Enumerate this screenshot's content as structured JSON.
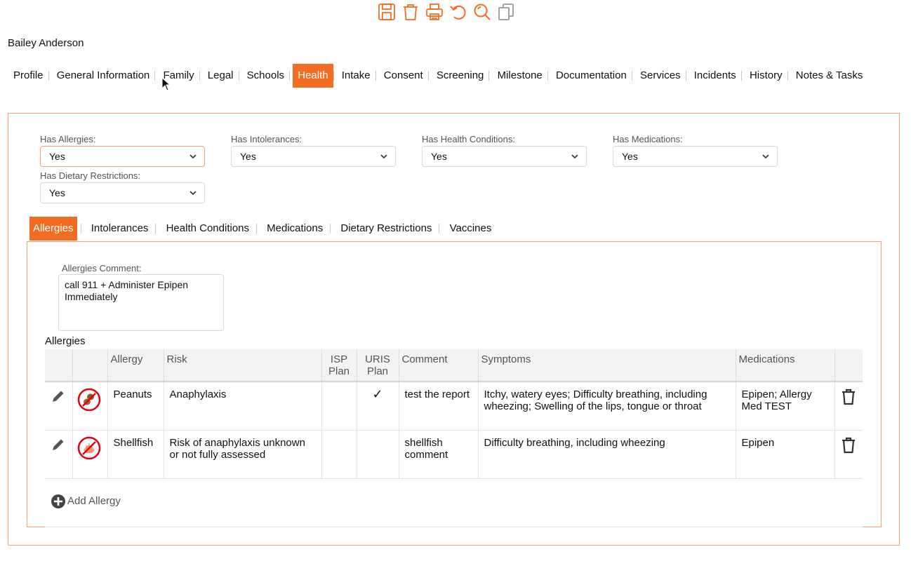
{
  "toolbar": {
    "accent_color": "#f26d21",
    "buttons": [
      {
        "name": "save-icon"
      },
      {
        "name": "trash-icon"
      },
      {
        "name": "printer-icon"
      },
      {
        "name": "undo-icon"
      },
      {
        "name": "search-icon"
      },
      {
        "name": "copy-icon"
      }
    ]
  },
  "student": {
    "name": "Bailey Anderson"
  },
  "main_nav": {
    "items": [
      "Profile",
      "General Information",
      "Family",
      "Legal",
      "Schools",
      "Health",
      "Intake",
      "Consent",
      "Screening",
      "Milestone",
      "Documentation",
      "Services",
      "Incidents",
      "History",
      "Notes & Tasks"
    ],
    "active": "Health"
  },
  "health_fields": {
    "has_allergies": {
      "label": "Has Allergies:",
      "value": "Yes"
    },
    "has_intolerances": {
      "label": "Has Intolerances:",
      "value": "Yes"
    },
    "has_health_conditions": {
      "label": "Has Health Conditions:",
      "value": "Yes"
    },
    "has_medications": {
      "label": "Has Medications:",
      "value": "Yes"
    },
    "has_dietary_restrictions": {
      "label": "Has Dietary Restrictions:",
      "value": "Yes"
    }
  },
  "sub_nav": {
    "items": [
      "Allergies",
      "Intolerances",
      "Health Conditions",
      "Medications",
      "Dietary Restrictions",
      "Vaccines"
    ],
    "active": "Allergies"
  },
  "allergies_comment": {
    "label": "Allergies Comment:",
    "value": "call 911 + Administer Epipen Immediately"
  },
  "allergies_table": {
    "heading": "Allergies",
    "columns": {
      "allergy": "Allergy",
      "risk": "Risk",
      "isp_plan_1": "ISP",
      "isp_plan_2": "Plan",
      "uris_plan_1": "URIS",
      "uris_plan_2": "Plan",
      "comment": "Comment",
      "symptoms": "Symptoms",
      "medications": "Medications"
    },
    "rows": [
      {
        "icon": "peanut-icon",
        "allergy": "Peanuts",
        "risk": "Anaphylaxis",
        "isp_plan": "",
        "uris_plan": "✓",
        "comment": "test the report",
        "symptoms": "Itchy, watery eyes; Difficulty breathing, including wheezing; Swelling of the lips, tongue or throat",
        "medications": "Epipen; Allergy Med TEST"
      },
      {
        "icon": "shellfish-icon",
        "allergy": "Shellfish",
        "risk": "Risk of anaphylaxis unknown or not fully assessed",
        "isp_plan": "",
        "uris_plan": "",
        "comment": "shellfish comment",
        "symptoms": "Difficulty breathing, including wheezing",
        "medications": "Epipen"
      }
    ],
    "add_label": "Add Allergy"
  }
}
